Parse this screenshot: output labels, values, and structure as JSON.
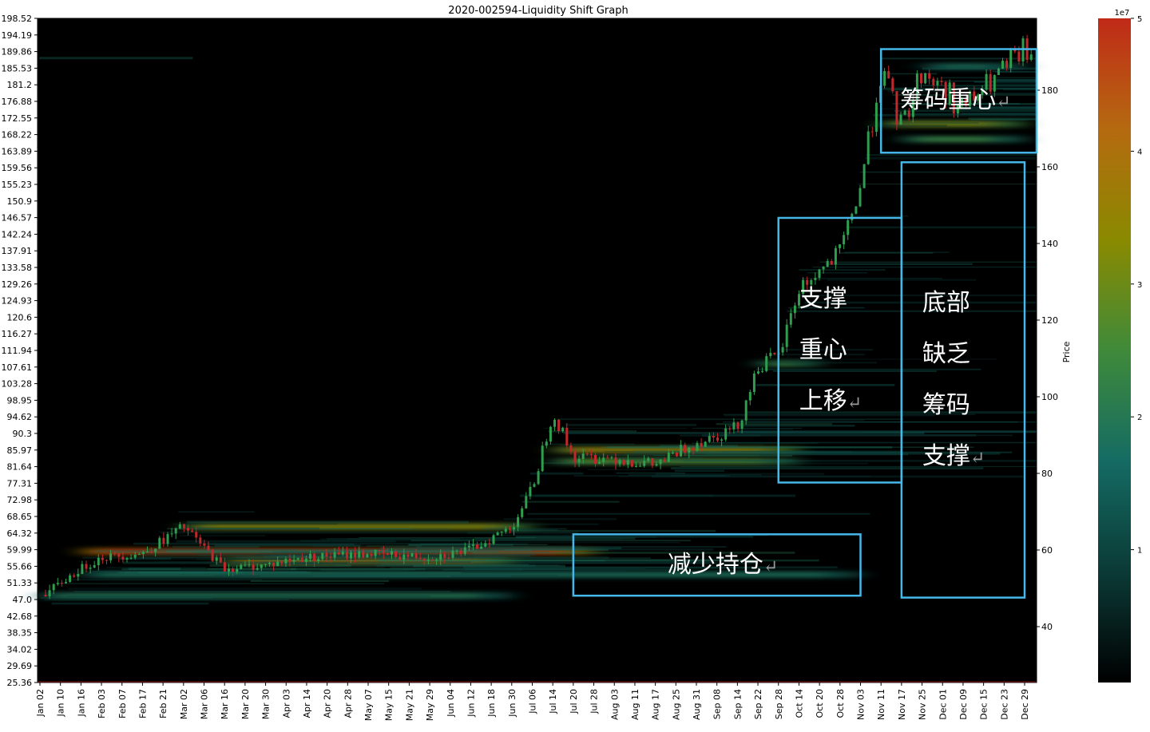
{
  "chart_data": {
    "type": "heatmap",
    "title": "2020-002594-Liquidity Shift Graph",
    "x_tick_labels": [
      "Jan 02",
      "Jan 10",
      "Jan 16",
      "Feb 03",
      "Feb 07",
      "Feb 17",
      "Feb 21",
      "Mar 02",
      "Mar 06",
      "Mar 16",
      "Mar 20",
      "Mar 30",
      "Apr 03",
      "Apr 14",
      "Apr 20",
      "Apr 28",
      "May 07",
      "May 15",
      "May 21",
      "May 29",
      "Jun 04",
      "Jun 12",
      "Jun 18",
      "Jun 30",
      "Jul 06",
      "Jul 14",
      "Jul 20",
      "Jul 28",
      "Aug 03",
      "Aug 11",
      "Aug 17",
      "Aug 25",
      "Aug 31",
      "Sep 08",
      "Sep 14",
      "Sep 22",
      "Sep 28",
      "Oct 14",
      "Oct 20",
      "Oct 28",
      "Nov 03",
      "Nov 11",
      "Nov 17",
      "Nov 25",
      "Dec 01",
      "Dec 09",
      "Dec 15",
      "Dec 23",
      "Dec 29"
    ],
    "left_y_tick_labels": [
      "198.52",
      "194.19",
      "189.86",
      "185.53",
      "181.2",
      "176.88",
      "172.55",
      "168.22",
      "163.89",
      "159.56",
      "155.23",
      "150.9",
      "146.57",
      "142.24",
      "137.91",
      "133.58",
      "129.26",
      "124.93",
      "120.6",
      "116.27",
      "111.94",
      "107.61",
      "103.28",
      "98.95",
      "94.62",
      "90.3",
      "85.97",
      "81.64",
      "77.31",
      "72.98",
      "68.65",
      "64.32",
      "59.99",
      "55.66",
      "51.33",
      "47.0",
      "42.68",
      "38.35",
      "34.02",
      "29.69",
      "25.36"
    ],
    "ylim": [
      25.36,
      198.52
    ],
    "right_axis": {
      "label": "Price",
      "ticks": [
        40,
        60,
        80,
        100,
        120,
        140,
        160,
        180
      ]
    },
    "colorbar": {
      "ticks": [
        "1",
        "2",
        "3",
        "4",
        "5"
      ],
      "exponent": "1e7",
      "range": [
        0,
        5
      ],
      "colors": [
        "#000000",
        "#0b3a36",
        "#146b63",
        "#3f8a3a",
        "#8a8a00",
        "#b56a10",
        "#c02a18"
      ]
    },
    "price_path": {
      "description_points": [
        [
          "Jan 02",
          47.5
        ],
        [
          "Jan 16",
          55
        ],
        [
          "Feb 03",
          58
        ],
        [
          "Feb 17",
          59
        ],
        [
          "Mar 02",
          66
        ],
        [
          "Mar 16",
          55
        ],
        [
          "Mar 30",
          56
        ],
        [
          "Apr 14",
          58
        ],
        [
          "May 07",
          59
        ],
        [
          "May 29",
          58
        ],
        [
          "Jun 12",
          60
        ],
        [
          "Jun 30",
          66
        ],
        [
          "Jul 06",
          76
        ],
        [
          "Jul 14",
          96
        ],
        [
          "Jul 20",
          84
        ],
        [
          "Aug 03",
          84
        ],
        [
          "Aug 17",
          82
        ],
        [
          "Aug 31",
          88
        ],
        [
          "Sep 14",
          92
        ],
        [
          "Sep 22",
          108
        ],
        [
          "Sep 28",
          110
        ],
        [
          "Oct 14",
          128
        ],
        [
          "Oct 28",
          137
        ],
        [
          "Nov 03",
          155
        ],
        [
          "Nov 11",
          185
        ],
        [
          "Nov 17",
          170
        ],
        [
          "Nov 25",
          185
        ],
        [
          "Dec 09",
          175
        ],
        [
          "Dec 23",
          185
        ],
        [
          "Dec 29",
          190
        ]
      ]
    },
    "density_bands": [
      {
        "price": 59.5,
        "from": "Jan 16",
        "to": "Jul 28",
        "peak": 5.0
      },
      {
        "price": 57.0,
        "from": "Mar 16",
        "to": "Jun 30",
        "peak": 4.0
      },
      {
        "price": 66.0,
        "from": "Mar 02",
        "to": "Jul 06",
        "peak": 3.4
      },
      {
        "price": 53.5,
        "from": "Jan 16",
        "to": "Nov 03",
        "peak": 1.8
      },
      {
        "price": 48.0,
        "from": "Jan 02",
        "to": "Jun 30",
        "peak": 2.0
      },
      {
        "price": 86.0,
        "from": "Jul 14",
        "to": "Oct 14",
        "peak": 3.6
      },
      {
        "price": 83.0,
        "from": "Jul 14",
        "to": "Oct 14",
        "peak": 2.8
      },
      {
        "price": 108.5,
        "from": "Sep 22",
        "to": "Oct 20",
        "peak": 2.6
      },
      {
        "price": 171.0,
        "from": "Nov 11",
        "to": "Dec 29",
        "peak": 3.2
      },
      {
        "price": 167.0,
        "from": "Nov 17",
        "to": "Dec 29",
        "peak": 2.4
      },
      {
        "price": 186.0,
        "from": "Nov 25",
        "to": "Dec 29",
        "peak": 1.8
      }
    ],
    "annotations": [
      {
        "lines": [
          "筹码重心"
        ],
        "ret": true,
        "box": {
          "x0": "Nov 11",
          "x1": "Dec 29+",
          "y0": 163.5,
          "y1": 190.5
        }
      },
      {
        "lines": [
          "支撑",
          "重心",
          "上移"
        ],
        "ret": true,
        "box": {
          "x0": "Sep 28",
          "x1": "Nov 17",
          "y0": 77.5,
          "y1": 146.5
        }
      },
      {
        "lines": [
          "底部",
          "缺乏",
          "筹码",
          "支撑"
        ],
        "ret": true,
        "box": {
          "x0": "Nov 17",
          "x1": "Dec 29",
          "y0": 47.5,
          "y1": 161.0
        }
      },
      {
        "lines": [
          "减少持仓"
        ],
        "ret": true,
        "box": {
          "x0": "Jul 20",
          "x1": "Nov 03",
          "y0": 48.0,
          "y1": 64.0
        }
      }
    ]
  },
  "colors": {
    "box": "#45b7e8",
    "up": "#2f9e4f",
    "down": "#c0282b"
  }
}
